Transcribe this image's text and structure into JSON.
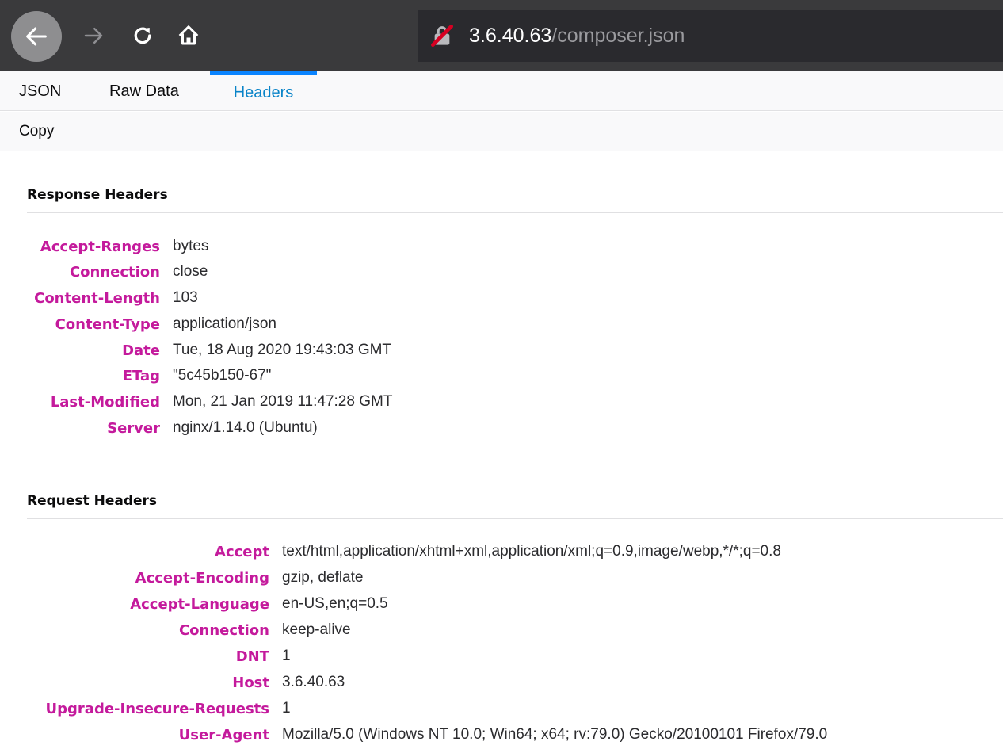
{
  "browser": {
    "nav": {
      "back": "back-arrow-icon",
      "forward": "forward-arrow-icon",
      "reload": "reload-icon",
      "home": "home-icon"
    },
    "url": {
      "host": "3.6.40.63",
      "path": "/composer.json",
      "security_icon": "insecure-lock-icon"
    }
  },
  "tabs": [
    {
      "label": "JSON",
      "active": false
    },
    {
      "label": "Raw Data",
      "active": false
    },
    {
      "label": "Headers",
      "active": true
    }
  ],
  "toolbar": {
    "copy_label": "Copy"
  },
  "response_headers": {
    "title": "Response Headers",
    "rows": [
      {
        "name": "Accept-Ranges",
        "value": "bytes"
      },
      {
        "name": "Connection",
        "value": "close"
      },
      {
        "name": "Content-Length",
        "value": "103"
      },
      {
        "name": "Content-Type",
        "value": "application/json"
      },
      {
        "name": "Date",
        "value": "Tue, 18 Aug 2020 19:43:03 GMT"
      },
      {
        "name": "ETag",
        "value": "\"5c45b150-67\""
      },
      {
        "name": "Last-Modified",
        "value": "Mon, 21 Jan 2019 11:47:28 GMT"
      },
      {
        "name": "Server",
        "value": "nginx/1.14.0 (Ubuntu)"
      }
    ]
  },
  "request_headers": {
    "title": "Request Headers",
    "rows": [
      {
        "name": "Accept",
        "value": "text/html,application/xhtml+xml,application/xml;q=0.9,image/webp,*/*;q=0.8"
      },
      {
        "name": "Accept-Encoding",
        "value": "gzip, deflate"
      },
      {
        "name": "Accept-Language",
        "value": "en-US,en;q=0.5"
      },
      {
        "name": "Connection",
        "value": "keep-alive"
      },
      {
        "name": "DNT",
        "value": "1"
      },
      {
        "name": "Host",
        "value": "3.6.40.63"
      },
      {
        "name": "Upgrade-Insecure-Requests",
        "value": "1"
      },
      {
        "name": "User-Agent",
        "value": "Mozilla/5.0 (Windows NT 10.0; Win64; x64; rv:79.0) Gecko/20100101 Firefox/79.0"
      }
    ]
  },
  "colors": {
    "header_name": "#c41a9c",
    "active_tab": "#0a84c8",
    "toolbar_bg": "#3a3a3c",
    "insecure_icon": "#d70022"
  }
}
